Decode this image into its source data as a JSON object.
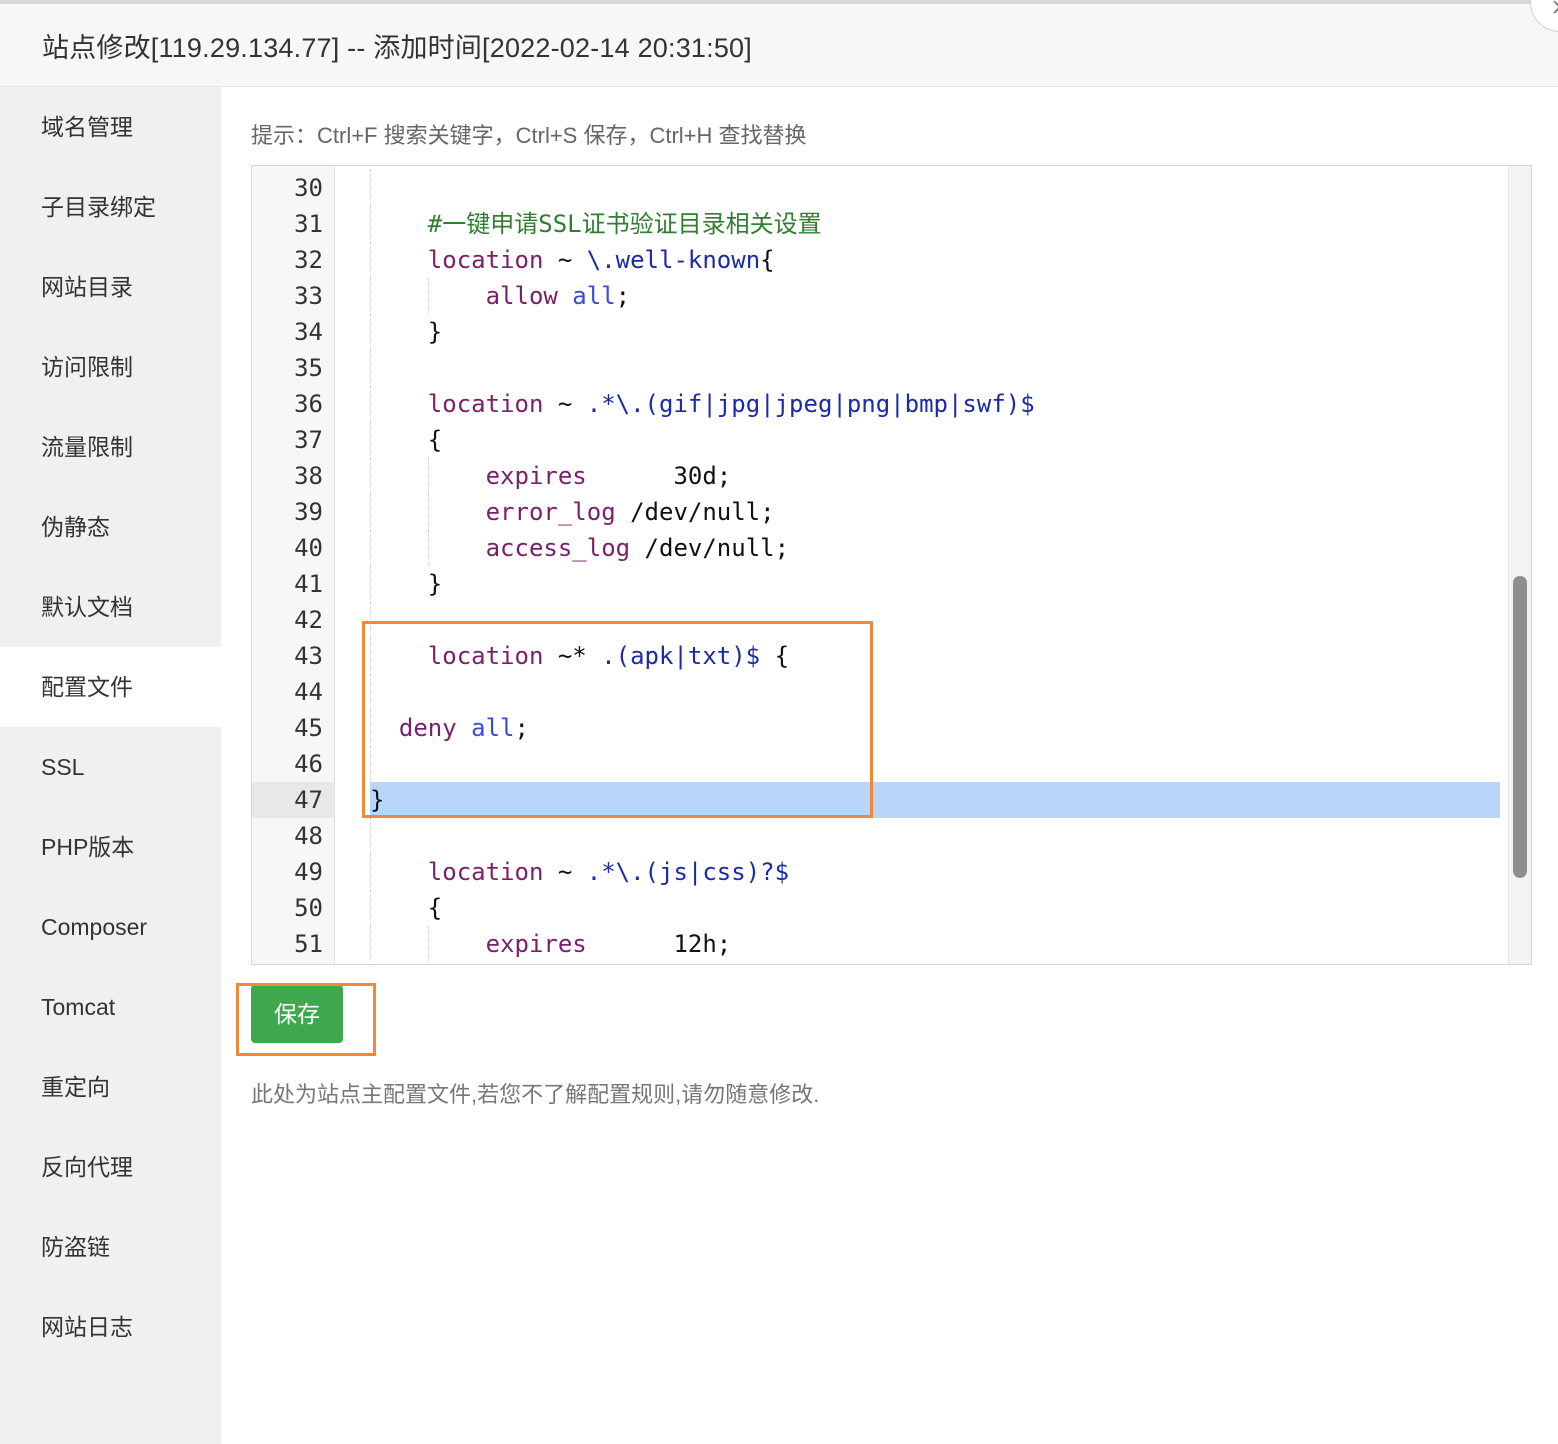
{
  "dialog": {
    "title": "站点修改[119.29.134.77] -- 添加时间[2022-02-14 20:31:50]",
    "close_label": "×"
  },
  "sidebar": {
    "items": [
      {
        "label": "域名管理"
      },
      {
        "label": "子目录绑定"
      },
      {
        "label": "网站目录"
      },
      {
        "label": "访问限制"
      },
      {
        "label": "流量限制"
      },
      {
        "label": "伪静态"
      },
      {
        "label": "默认文档"
      },
      {
        "label": "配置文件",
        "active": true
      },
      {
        "label": "SSL"
      },
      {
        "label": "PHP版本"
      },
      {
        "label": "Composer"
      },
      {
        "label": "Tomcat"
      },
      {
        "label": "重定向"
      },
      {
        "label": "反向代理"
      },
      {
        "label": "防盗链"
      },
      {
        "label": "网站日志"
      }
    ]
  },
  "main": {
    "hint": "提示：Ctrl+F 搜索关键字，Ctrl+S 保存，Ctrl+H 查找替换",
    "save_label": "保存",
    "note": "此处为站点主配置文件,若您不了解配置规则,请勿随意修改."
  },
  "editor": {
    "active_line": 47,
    "scroll_fraction": 0.52,
    "lines": [
      {
        "num": "30",
        "text": ""
      },
      {
        "num": "31",
        "text": "    #一键申请SSL证书验证目录相关设置"
      },
      {
        "num": "32",
        "text": "    location ~ \\.well-known{"
      },
      {
        "num": "33",
        "text": "        allow all;"
      },
      {
        "num": "34",
        "text": "    }"
      },
      {
        "num": "35",
        "text": ""
      },
      {
        "num": "36",
        "text": "    location ~ .*\\.(gif|jpg|jpeg|png|bmp|swf)$"
      },
      {
        "num": "37",
        "text": "    {"
      },
      {
        "num": "38",
        "text": "        expires      30d;"
      },
      {
        "num": "39",
        "text": "        error_log /dev/null;"
      },
      {
        "num": "40",
        "text": "        access_log /dev/null;"
      },
      {
        "num": "41",
        "text": "    }"
      },
      {
        "num": "42",
        "text": ""
      },
      {
        "num": "43",
        "text": "    location ~* .(apk|txt)$ {"
      },
      {
        "num": "44",
        "text": ""
      },
      {
        "num": "45",
        "text": "  deny all;"
      },
      {
        "num": "46",
        "text": ""
      },
      {
        "num": "47",
        "text": "}"
      },
      {
        "num": "48",
        "text": ""
      },
      {
        "num": "49",
        "text": "    location ~ .*\\.(js|css)?$"
      },
      {
        "num": "50",
        "text": "    {"
      },
      {
        "num": "51",
        "text": "        expires      12h;"
      }
    ]
  },
  "colors": {
    "keyword": "#7a1f6a",
    "atom": "#3c4bd6",
    "string": "#1b2aa8",
    "comment": "#2f7f2f",
    "save_button": "#3fa74e",
    "annotation_box": "#f0883a",
    "active_line": "#b9d6fa"
  }
}
